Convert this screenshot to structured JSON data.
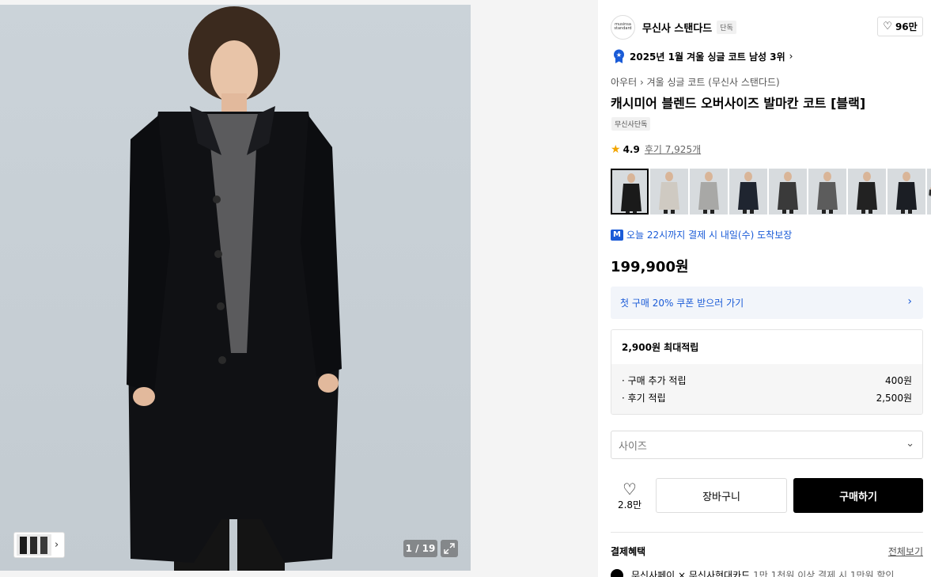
{
  "gallery": {
    "counter": "1 / 19",
    "expand_icon": "expand-icon",
    "thumb_nav_icon": "chevron-right-icon"
  },
  "brand": {
    "logo_text": "musinsa standard",
    "name": "무신사 스탠다드",
    "tag": "단독",
    "likes": "96만"
  },
  "ranking": {
    "text": "2025년 1월 겨울 싱글 코트 남성 3위",
    "icon": "award-badge-icon"
  },
  "breadcrumb": {
    "level1": "아우터",
    "level2": "겨울 싱글 코트 (무신사 스탠다드)"
  },
  "product": {
    "title": "캐시미어 블렌드 오버사이즈 발마칸 코트 [블랙]",
    "exclusive_tag": "무신사단독",
    "rating": "4.9",
    "reviews": "후기 7,925개",
    "price": "199,900원"
  },
  "color_thumbnails": [
    {
      "name": "black",
      "color": "#1a1a1a"
    },
    {
      "name": "light-beige",
      "color": "#cfcac2"
    },
    {
      "name": "gray",
      "color": "#a8a8a6"
    },
    {
      "name": "dark-scene",
      "color": "#1f2530"
    },
    {
      "name": "charcoal",
      "color": "#3a3a3a"
    },
    {
      "name": "mid-gray",
      "color": "#5c5c5c"
    },
    {
      "name": "black-2",
      "color": "#222222"
    },
    {
      "name": "navy-black",
      "color": "#1b1e24"
    },
    {
      "name": "partial",
      "color": "#2a2a2a"
    }
  ],
  "delivery": {
    "badge": "M",
    "text": "오늘 22시까지 결제 시 내일(수) 도착보장"
  },
  "coupon": {
    "text": "첫 구매 20% 쿠폰 받으러 가기"
  },
  "points": {
    "max": "2,900원 최대적립",
    "rows": [
      {
        "label": "· 구매 추가 적립",
        "value": "400원"
      },
      {
        "label": "· 후기 적립",
        "value": "2,500원"
      }
    ]
  },
  "size": {
    "placeholder": "사이즈"
  },
  "actions": {
    "wish_count": "2.8만",
    "cart": "장바구니",
    "buy": "구매하기"
  },
  "benefits": {
    "title": "결제혜택",
    "view_all": "전체보기",
    "line_main": "무신사페이 × 무신사현대카드",
    "line_desc": "1만 1천원 이상 결제 시 1만원 할인"
  },
  "colors": {
    "accent_blue": "#1a5bd7",
    "star": "#f2a500",
    "buy_button": "#000000"
  }
}
